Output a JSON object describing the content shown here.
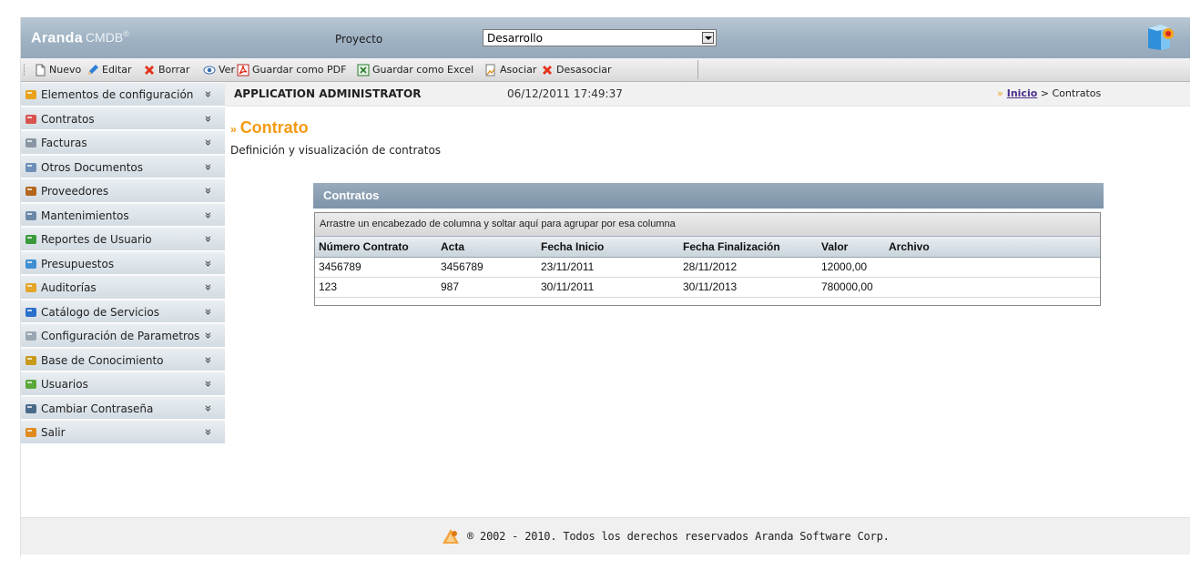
{
  "header": {
    "brand": "Aranda",
    "product": "CMDB",
    "project_label": "Proyecto",
    "project_value": "Desarrollo"
  },
  "toolbar": {
    "buttons": [
      {
        "label": "Nuevo",
        "icon": "new-document-icon"
      },
      {
        "label": "Editar",
        "icon": "pencil-icon"
      },
      {
        "label": "Borrar",
        "icon": "delete-x-icon"
      },
      {
        "label": "Ver",
        "icon": "eye-icon"
      },
      {
        "label": "Guardar como PDF",
        "icon": "pdf-icon"
      },
      {
        "label": "Guardar como Excel",
        "icon": "excel-icon"
      },
      {
        "label": "Asociar",
        "icon": "associate-icon"
      },
      {
        "label": "Desasociar",
        "icon": "delete-x-icon"
      }
    ]
  },
  "sidebar": {
    "items": [
      {
        "label": "Elementos de configuración",
        "icon": "config-elements-icon"
      },
      {
        "label": "Contratos",
        "icon": "contract-pen-icon"
      },
      {
        "label": "Facturas",
        "icon": "invoice-icon"
      },
      {
        "label": "Otros Documentos",
        "icon": "documents-icon"
      },
      {
        "label": "Proveedores",
        "icon": "provider-person-icon"
      },
      {
        "label": "Mantenimientos",
        "icon": "maintenance-icon"
      },
      {
        "label": "Reportes de Usuario",
        "icon": "reports-icon"
      },
      {
        "label": "Presupuestos",
        "icon": "budget-icon"
      },
      {
        "label": "Auditorías",
        "icon": "audit-icon"
      },
      {
        "label": "Catálogo de Servicios",
        "icon": "service-catalog-icon"
      },
      {
        "label": "Configuración de Parametros",
        "icon": "gear-icon"
      },
      {
        "label": "Base de Conocimiento",
        "icon": "knowledge-base-icon"
      },
      {
        "label": "Usuarios",
        "icon": "users-icon"
      },
      {
        "label": "Cambiar Contraseña",
        "icon": "password-icon"
      },
      {
        "label": "Salir",
        "icon": "exit-icon"
      }
    ],
    "chevron": "»"
  },
  "infobar": {
    "user": "APPLICATION ADMINISTRATOR",
    "datetime": "06/12/2011 17:49:37",
    "breadcrumb_home": "Inicio",
    "breadcrumb_current": "> Contratos"
  },
  "page": {
    "title": "Contrato",
    "description": "Definición y visualización de contratos"
  },
  "grid": {
    "title": "Contratos",
    "group_hint": "Arrastre un encabezado de columna y soltar aquí para agrupar por esa columna",
    "columns": [
      "Número Contrato",
      "Acta",
      "Fecha Inicio",
      "Fecha Finalización",
      "Valor",
      "Archivo"
    ],
    "rows": [
      [
        "3456789",
        "3456789",
        "23/11/2011",
        "28/11/2012",
        "12000,00",
        ""
      ],
      [
        "123",
        "987",
        "30/11/2011",
        "30/11/2013",
        "780000,00",
        ""
      ]
    ]
  },
  "footer": {
    "text": "® 2002 - 2010. Todos los derechos reservados Aranda Software Corp."
  },
  "colors": {
    "accent_orange": "#f39a12",
    "header_blue": "#9fb2c3",
    "grid_head": "#8aa0b3"
  }
}
